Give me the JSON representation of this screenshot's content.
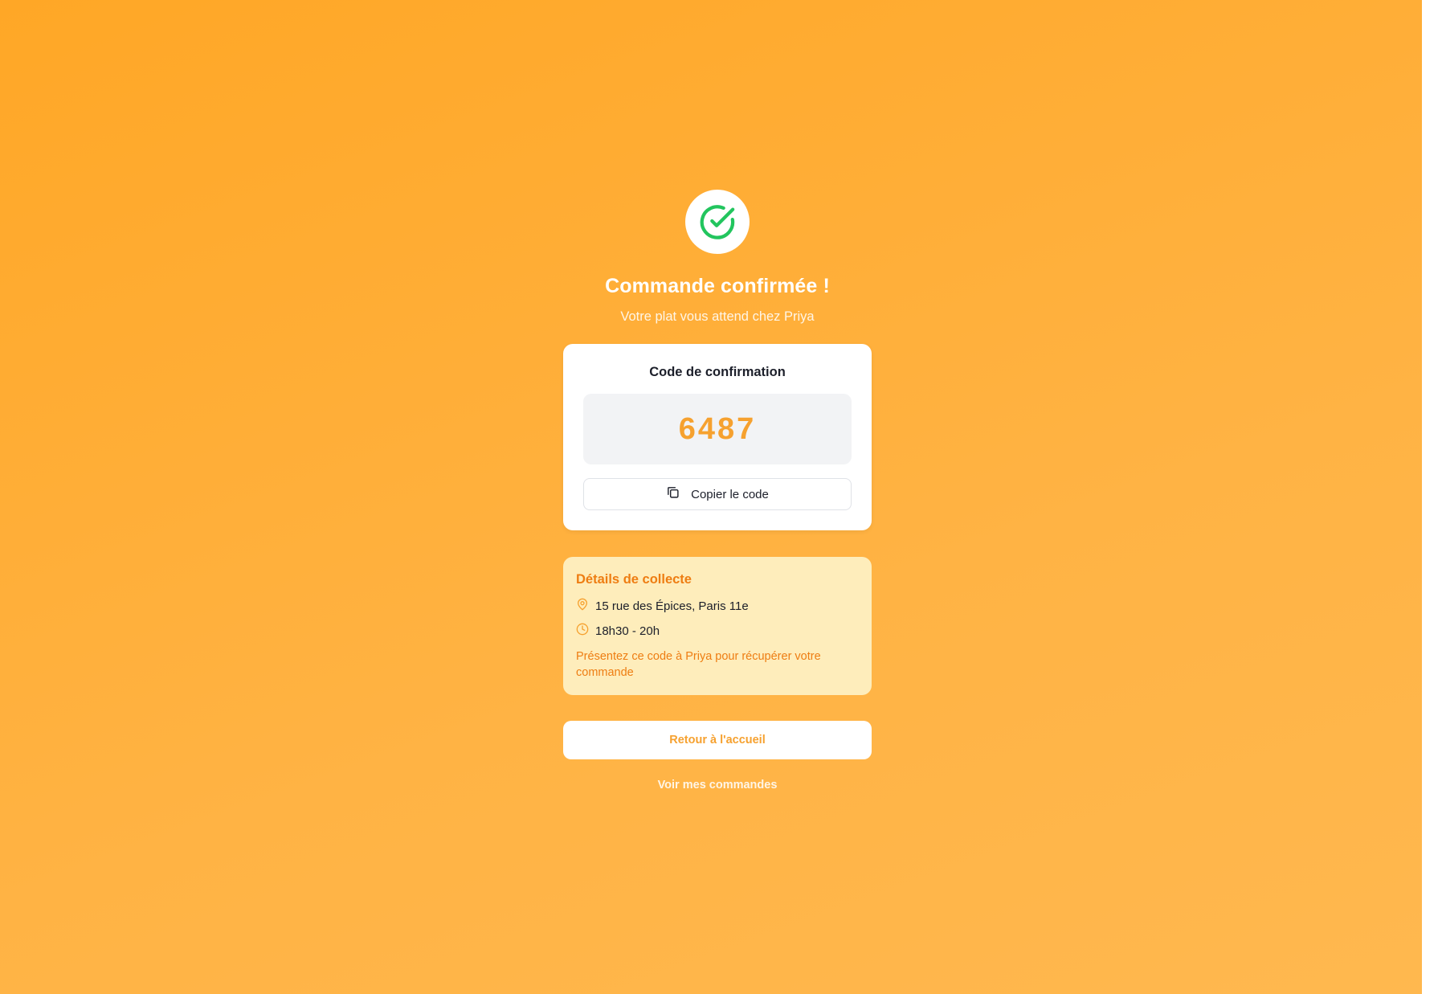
{
  "header": {
    "title": "Commande confirmée !",
    "subtitle": "Votre plat vous attend chez Priya",
    "icon": "check-circle-icon"
  },
  "code_card": {
    "title": "Code de confirmation",
    "code": "6487",
    "copy_label": "Copier le code",
    "copy_icon": "copy-icon"
  },
  "details": {
    "title": "Détails de collecte",
    "address": "15 rue des Épices, Paris 11e",
    "address_icon": "map-pin-icon",
    "time": "18h30 - 20h",
    "time_icon": "clock-icon",
    "note": "Présentez ce code à Priya pour récupérer votre commande"
  },
  "actions": {
    "home_label": "Retour à l'accueil",
    "orders_label": "Voir mes commandes"
  },
  "colors": {
    "background": "#ffa726",
    "accent": "#f6a12f",
    "details_bg": "#feedbb",
    "details_accent": "#ee7d12",
    "success": "#22c55e"
  }
}
